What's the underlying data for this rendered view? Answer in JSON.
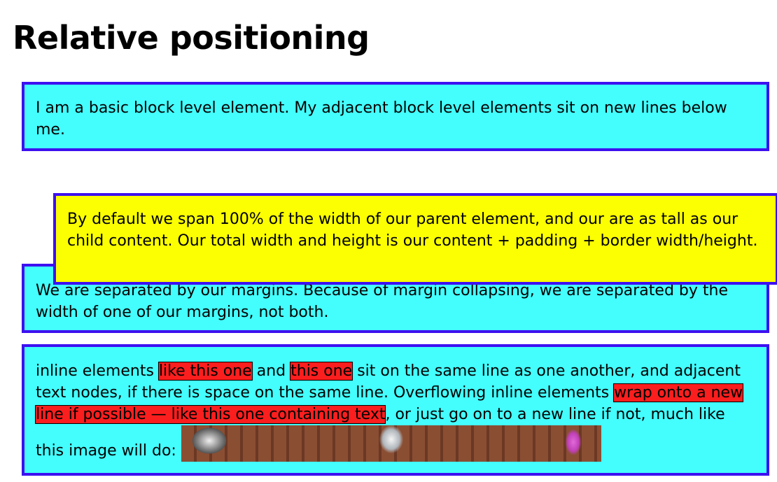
{
  "page": {
    "heading": "Relative positioning"
  },
  "box1": {
    "text": "I am a basic block level element. My adjacent block level elements sit on new lines below me."
  },
  "box2": {
    "text": "By default we span 100% of the width of our parent element, and our are as tall as our child content. Our total width and height is our content + padding + border width/height."
  },
  "box3": {
    "text": "We are separated by our margins. Because of margin collapsing, we are separated by the width of one of our margins, not both."
  },
  "box4": {
    "seg1": "inline elements ",
    "span1": "like this one",
    "seg2": " and ",
    "span2": "this one",
    "seg3": " sit on the same line as one another, and adjacent text nodes, if there is space on the same line. Overflowing inline elements ",
    "span3": "wrap onto a new line if possible — like this one containing text",
    "seg4": ", or just go on to a new line if not, much like this image will do: "
  },
  "colors": {
    "cyan": "#44fdfd",
    "yellow": "#fbff02",
    "border": "#3d10f0",
    "red": "#fb1e1e"
  },
  "image": {
    "icon": "photo-image"
  }
}
